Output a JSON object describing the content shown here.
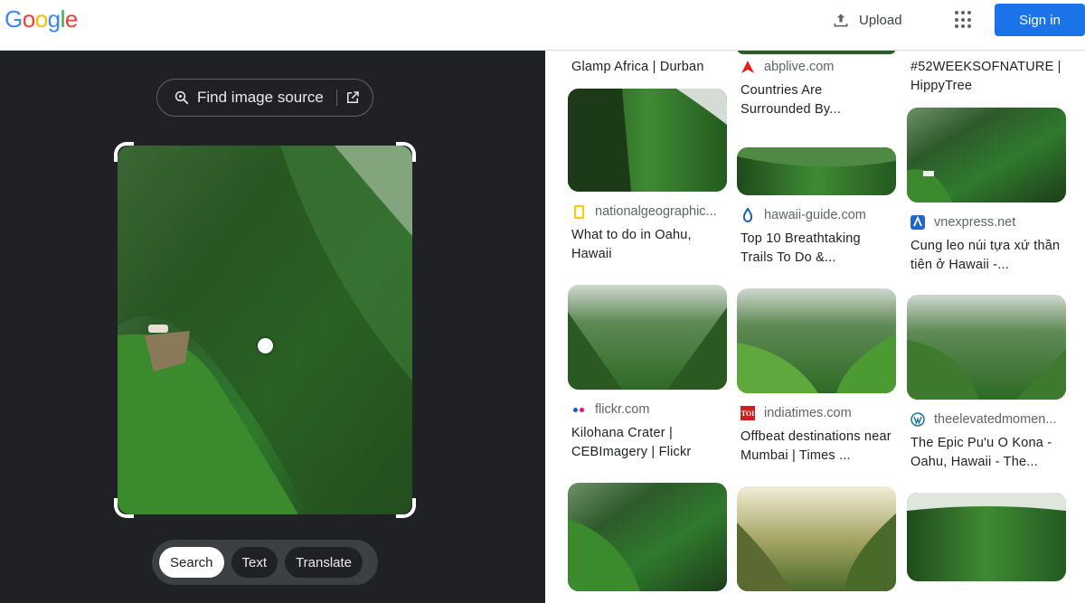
{
  "header": {
    "logo": "Google",
    "upload_label": "Upload",
    "signin_label": "Sign in",
    "colors": {
      "blue": "#4285F4",
      "red": "#EA4335",
      "yellow": "#FBBC05",
      "green": "#34A853",
      "accent": "#1a73e8"
    }
  },
  "lens": {
    "find_source_label": "Find image source",
    "modes": [
      {
        "label": "Search",
        "active": true
      },
      {
        "label": "Text",
        "active": false
      },
      {
        "label": "Translate",
        "active": false
      }
    ]
  },
  "results": {
    "col1": [
      {
        "title": "Glamp Africa | Durban"
      },
      {
        "source": "nationalgeographic...",
        "title": "What to do in Oahu, Hawaii",
        "icon": "nat-geo-icon"
      },
      {
        "source": "flickr.com",
        "title": "Kilohana Crater | CEBImagery | Flickr",
        "icon": "flickr-icon"
      }
    ],
    "col2": [
      {
        "source": "abplive.com",
        "title": "Countries Are Surrounded By...",
        "icon": "abplive-icon"
      },
      {
        "source": "hawaii-guide.com",
        "title": "Top 10 Breathtaking Trails To Do &...",
        "icon": "hawaii-guide-icon"
      },
      {
        "source": "indiatimes.com",
        "title": "Offbeat destinations near Mumbai | Times ...",
        "icon": "toi-icon",
        "icon_text": "TOI"
      }
    ],
    "col3": [
      {
        "title": "#52WEEKSOFNATURE | HippyTree"
      },
      {
        "source": "vnexpress.net",
        "title": "Cung leo núi tựa xứ thần tiên ở Hawaii -...",
        "icon": "vnexpress-icon"
      },
      {
        "source": "theelevatedmomen...",
        "title": "The Epic Pu'u O Kona - Oahu, Hawaii - The...",
        "icon": "wordpress-icon"
      }
    ]
  }
}
